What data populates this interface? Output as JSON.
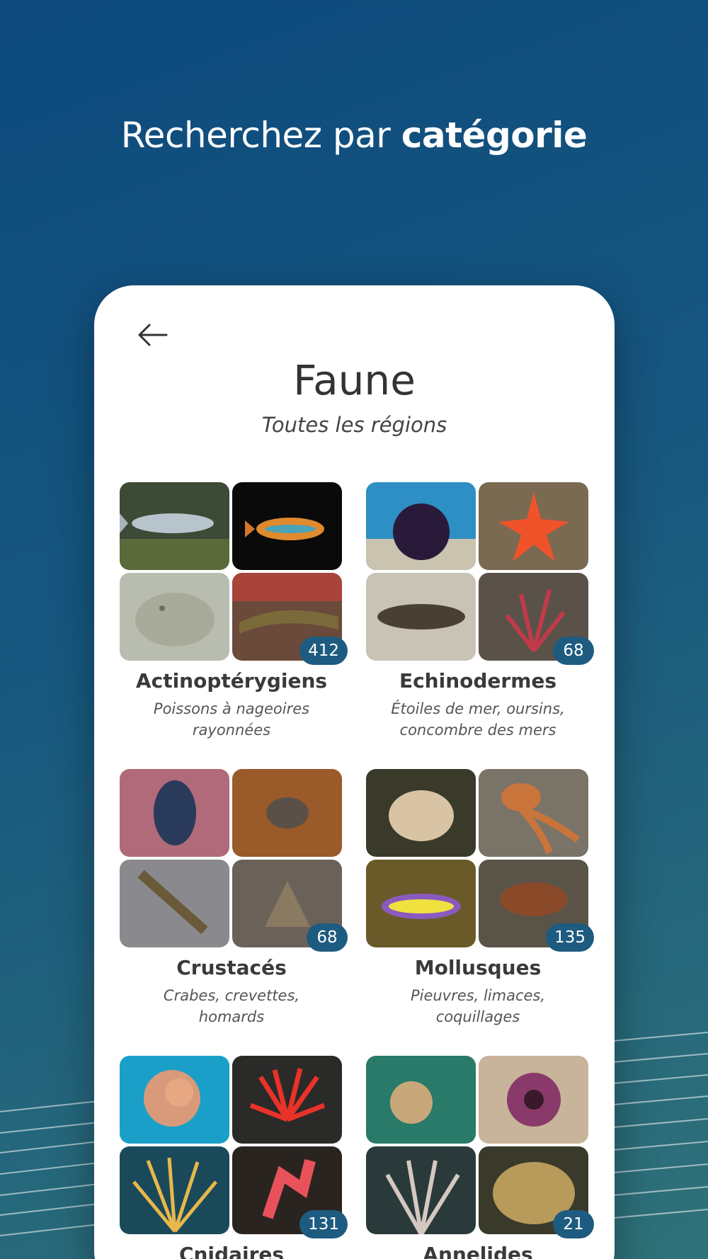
{
  "headline": {
    "regular": "Recherchez par ",
    "bold": "catégorie"
  },
  "screen": {
    "back_icon": "arrow-left-icon",
    "title": "Faune",
    "subtitle": "Toutes les régions"
  },
  "categories": [
    {
      "name": "Actinoptérygiens",
      "desc1": "Poissons à nageoires",
      "desc2": "rayonnées",
      "count": "412"
    },
    {
      "name": "Echinodermes",
      "desc1": "Étoiles de mer, oursins,",
      "desc2": "concombre des mers",
      "count": "68"
    },
    {
      "name": "Crustacés",
      "desc1": "Crabes, crevettes,",
      "desc2": "homards",
      "count": "68"
    },
    {
      "name": "Mollusques",
      "desc1": "Pieuvres, limaces,",
      "desc2": "coquillages",
      "count": "135"
    },
    {
      "name": "Cnidaires",
      "desc1": "",
      "desc2": "",
      "count": "131"
    },
    {
      "name": "Annelides",
      "desc1": "",
      "desc2": "",
      "count": "21"
    }
  ],
  "colors": {
    "accent": "#1e5b80",
    "background_top": "#0d4a7e",
    "background_bottom": "#2f7279"
  }
}
